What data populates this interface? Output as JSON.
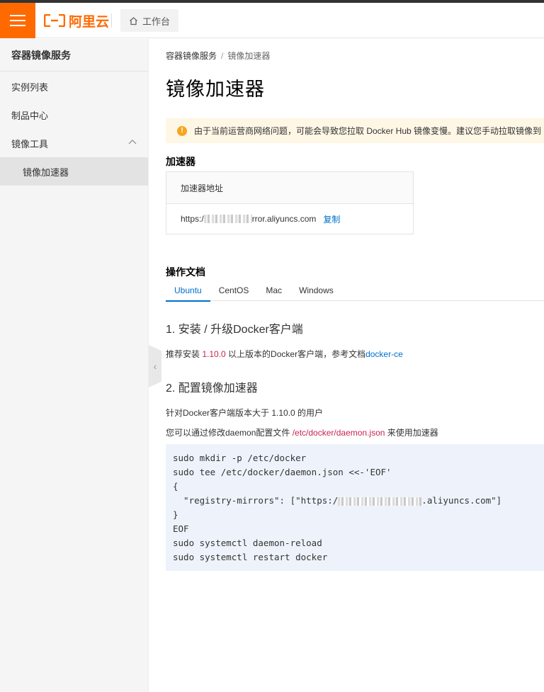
{
  "header": {
    "logo_text": "阿里云",
    "workbench_label": "工作台",
    "accent": "#ff6a00"
  },
  "sidebar": {
    "title": "容器镜像服务",
    "items": [
      {
        "label": "实例列表"
      },
      {
        "label": "制品中心"
      },
      {
        "label": "镜像工具"
      },
      {
        "label": "镜像加速器"
      }
    ]
  },
  "breadcrumb": {
    "parent": "容器镜像服务",
    "current": "镜像加速器",
    "sep": "/"
  },
  "page": {
    "title": "镜像加速器"
  },
  "notice": {
    "text": "由于当前运营商网络问题，可能会导致您拉取 Docker Hub 镜像变慢。建议您手动拉取镜像到"
  },
  "accelerator": {
    "section_title": "加速器",
    "column_header": "加速器地址",
    "address_prefix": "https:/",
    "address_suffix": "rror.aliyuncs.com",
    "copy_label": "复制"
  },
  "docs": {
    "section_title": "操作文档",
    "tabs": [
      "Ubuntu",
      "CentOS",
      "Mac",
      "Windows"
    ],
    "active_tab": "Ubuntu",
    "step1": {
      "title": "1. 安装 / 升级Docker客户端",
      "text_before": "推荐安装 ",
      "version": "1.10.0",
      "text_middle": " 以上版本的Docker客户端，参考文档",
      "link": "docker-ce"
    },
    "step2": {
      "title": "2. 配置镜像加速器",
      "line1": "针对Docker客户端版本大于 1.10.0 的用户",
      "line2_before": "您可以通过修改daemon配置文件 ",
      "config_path": "/etc/docker/daemon.json",
      "line2_after": " 来使用加速器"
    },
    "code": {
      "line1": "sudo mkdir -p /etc/docker",
      "line2": "sudo tee /etc/docker/daemon.json <<-'EOF'",
      "line3": "{",
      "line4_prefix": "  \"registry-mirrors\": [\"https:/",
      "line4_suffix": ".aliyuncs.com\"]",
      "line5": "}",
      "line6": "EOF",
      "line7": "sudo systemctl daemon-reload",
      "line8": "sudo systemctl restart docker"
    }
  }
}
